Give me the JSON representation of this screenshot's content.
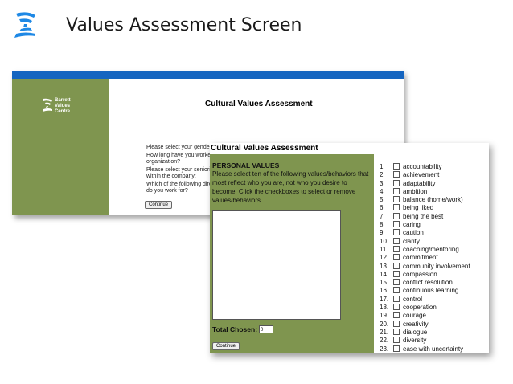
{
  "slide": {
    "title": "Values Assessment Screen"
  },
  "back_window": {
    "brand_text": "Barrett\nValues\nCentre",
    "heading": "Cultural Values Assessment",
    "questions": [
      "Please select your gender:",
      "How long have you worked for the organization?",
      "Please select your seniority level within the company:",
      "Which of the following directorates do you work for?"
    ],
    "continue_label": "Continue"
  },
  "front_window": {
    "heading": "Cultural Values Assessment",
    "section_title": "PERSONAL VALUES",
    "instructions": "Please select ten of the following values/behaviors that most reflect who you are, not who you desire to become. Click the checkboxes to select or remove values/behaviors.",
    "total_label": "Total Chosen:",
    "total_value": "0",
    "continue_label": "Continue",
    "values": [
      {
        "num": "1.",
        "label": "accountability"
      },
      {
        "num": "2.",
        "label": "achievement"
      },
      {
        "num": "3.",
        "label": "adaptability"
      },
      {
        "num": "4.",
        "label": "ambition"
      },
      {
        "num": "5.",
        "label": "balance (home/work)"
      },
      {
        "num": "6.",
        "label": "being liked"
      },
      {
        "num": "7.",
        "label": "being the best"
      },
      {
        "num": "8.",
        "label": "caring"
      },
      {
        "num": "9.",
        "label": "caution"
      },
      {
        "num": "10.",
        "label": "clarity"
      },
      {
        "num": "11.",
        "label": "coaching/mentoring"
      },
      {
        "num": "12.",
        "label": "commitment"
      },
      {
        "num": "13.",
        "label": "community involvement"
      },
      {
        "num": "14.",
        "label": "compassion"
      },
      {
        "num": "15.",
        "label": "conflict resolution"
      },
      {
        "num": "16.",
        "label": "continuous learning"
      },
      {
        "num": "17.",
        "label": "control"
      },
      {
        "num": "18.",
        "label": "cooperation"
      },
      {
        "num": "19.",
        "label": "courage"
      },
      {
        "num": "20.",
        "label": "creativity"
      },
      {
        "num": "21.",
        "label": "dialogue"
      },
      {
        "num": "22.",
        "label": "diversity"
      },
      {
        "num": "23.",
        "label": "ease with uncertainty"
      }
    ]
  },
  "colors": {
    "accent_green": "#7f954f",
    "title_bar_blue": "#1565c0",
    "logo_blue": "#1e88e5"
  }
}
